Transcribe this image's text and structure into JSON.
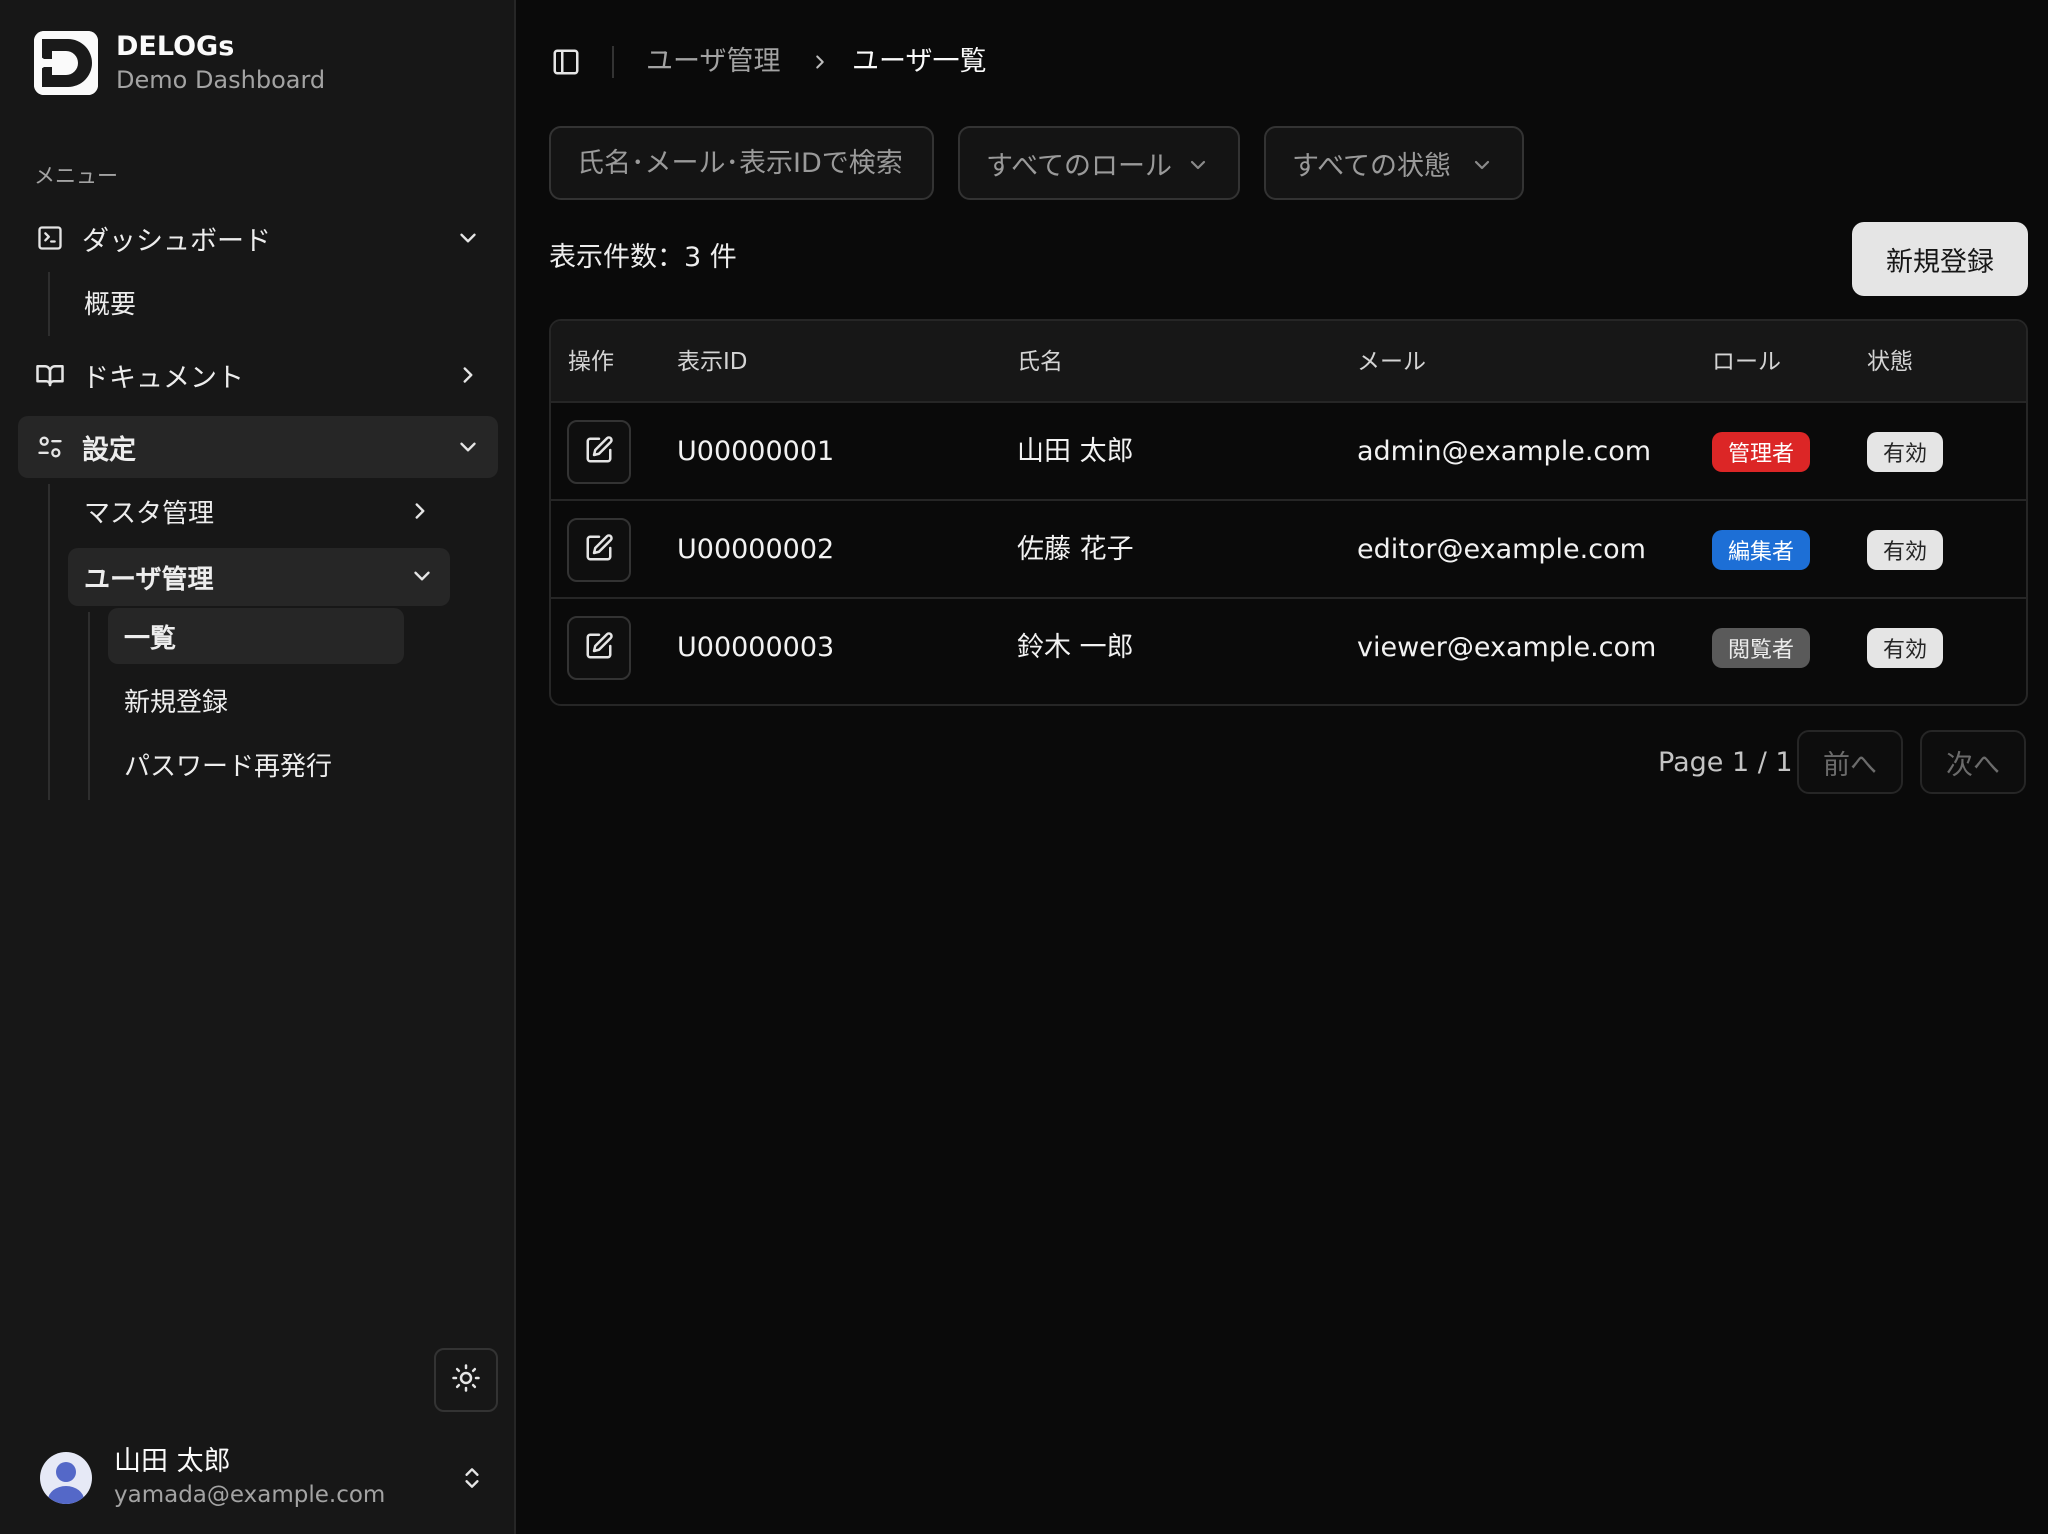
{
  "brand": {
    "title": "DELOGs",
    "subtitle": "Demo Dashboard"
  },
  "sidebar": {
    "menu_label": "メニュー",
    "items": [
      {
        "label": "ダッシュボード",
        "icon": "terminal-icon",
        "chevron": "down",
        "children": [
          {
            "label": "概要"
          }
        ]
      },
      {
        "label": "ドキュメント",
        "icon": "book-icon",
        "chevron": "right"
      },
      {
        "label": "設定",
        "icon": "settings-sliders-icon",
        "chevron": "down",
        "active": true,
        "children": [
          {
            "label": "マスタ管理",
            "chevron": "right"
          },
          {
            "label": "ユーザ管理",
            "chevron": "down",
            "active": true,
            "children": [
              {
                "label": "一覧",
                "active": true
              },
              {
                "label": "新規登録"
              },
              {
                "label": "パスワード再発行"
              }
            ]
          }
        ]
      }
    ],
    "theme_icon": "sun-icon",
    "user": {
      "name": "山田 太郎",
      "email": "yamada@example.com"
    }
  },
  "breadcrumb": {
    "parent": "ユーザ管理",
    "current": "ユーザ一覧"
  },
  "filters": {
    "search_placeholder": "氏名･メール･表示IDで検索",
    "role_selected": "すべてのロール",
    "status_selected": "すべての状態"
  },
  "count_text": "表示件数：3 件",
  "new_button": "新規登録",
  "table": {
    "headers": {
      "action": "操作",
      "id": "表示ID",
      "name": "氏名",
      "email": "メール",
      "role": "ロール",
      "status": "状態"
    },
    "rows": [
      {
        "id": "U00000001",
        "name": "山田 太郎",
        "email": "admin@example.com",
        "role": "管理者",
        "status": "有効"
      },
      {
        "id": "U00000002",
        "name": "佐藤 花子",
        "email": "editor@example.com",
        "role": "編集者",
        "status": "有効"
      },
      {
        "id": "U00000003",
        "name": "鈴木 一郎",
        "email": "viewer@example.com",
        "role": "閲覧者",
        "status": "有効"
      }
    ]
  },
  "colors": {
    "role_admin": "#dc2626",
    "role_editor": "#1d6fd6",
    "role_viewer": "#5a5a5a"
  },
  "pagination": {
    "page_text": "Page 1 / 1",
    "prev": "前へ",
    "next": "次へ"
  }
}
